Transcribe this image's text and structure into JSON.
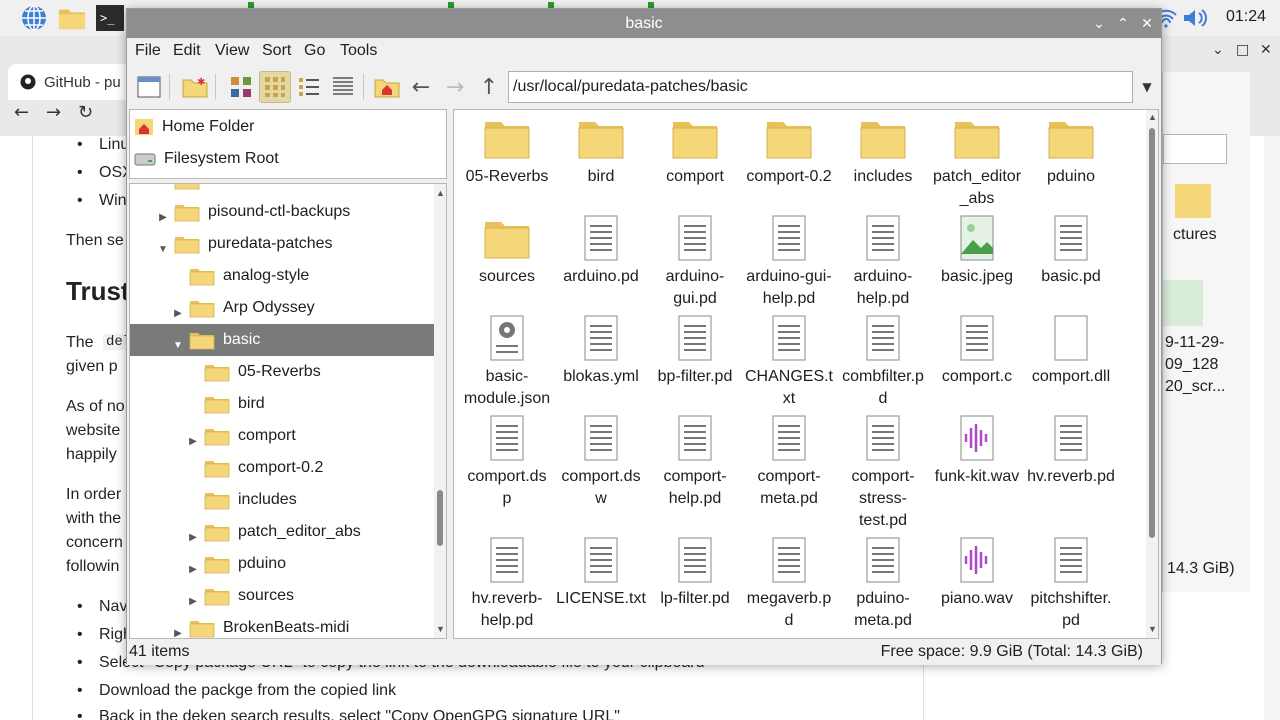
{
  "taskbar": {
    "clock": "01:24"
  },
  "browser": {
    "tab_label": "GitHub - pu",
    "doc_lines": {
      "linux": "Linu",
      "osx": "OSX",
      "win": "Win",
      "then": "Then se",
      "heading": "Trust",
      "the": "The",
      "code": "del",
      "given": "given p",
      "asof": "As of no",
      "website": "website",
      "happily": "happily",
      "inorder": "In order",
      "withthe": "with the",
      "concern": "concern",
      "following": "followin",
      "nav": "Nav",
      "right": "Righ",
      "select": "Select \"Copy package URL\" to copy the link to the downloadable file to your clipboard",
      "download": "Download the packge from the copied link",
      "back": "Back in the deken search results, select \"Copy OpenGPG signature URL\""
    },
    "right_win": {
      "label_1": "ctures",
      "label_2": "9-11-29-",
      "label_3": "09_128",
      "label_4": "20_scr...",
      "free": "14.3 GiB)"
    }
  },
  "file_manager": {
    "title": "basic",
    "menu": [
      "File",
      "Edit",
      "View",
      "Sort",
      "Go",
      "Tools"
    ],
    "path": "/usr/local/puredata-patches/basic",
    "places": [
      "Home Folder",
      "Filesystem Root"
    ],
    "tree": [
      {
        "label": "",
        "indent": 0,
        "arrow": ""
      },
      {
        "label": "pisound-ctl-backups",
        "indent": 0,
        "arrow": "▶"
      },
      {
        "label": "puredata-patches",
        "indent": 0,
        "arrow": "▼"
      },
      {
        "label": "analog-style",
        "indent": 1,
        "arrow": ""
      },
      {
        "label": "Arp Odyssey",
        "indent": 1,
        "arrow": "▶"
      },
      {
        "label": "basic",
        "indent": 1,
        "arrow": "▼",
        "selected": true
      },
      {
        "label": "05-Reverbs",
        "indent": 2,
        "arrow": ""
      },
      {
        "label": "bird",
        "indent": 2,
        "arrow": ""
      },
      {
        "label": "comport",
        "indent": 2,
        "arrow": "▶"
      },
      {
        "label": "comport-0.2",
        "indent": 2,
        "arrow": ""
      },
      {
        "label": "includes",
        "indent": 2,
        "arrow": ""
      },
      {
        "label": "patch_editor_abs",
        "indent": 2,
        "arrow": "▶"
      },
      {
        "label": "pduino",
        "indent": 2,
        "arrow": "▶"
      },
      {
        "label": "sources",
        "indent": 2,
        "arrow": "▶"
      },
      {
        "label": "BrokenBeats-midi",
        "indent": 1,
        "arrow": "▶"
      }
    ],
    "files": [
      {
        "l1": "05-Reverbs",
        "l2": "",
        "l3": "",
        "type": "folder"
      },
      {
        "l1": "bird",
        "l2": "",
        "l3": "",
        "type": "folder"
      },
      {
        "l1": "comport",
        "l2": "",
        "l3": "",
        "type": "folder"
      },
      {
        "l1": "comport-0.2",
        "l2": "",
        "l3": "",
        "type": "folder"
      },
      {
        "l1": "includes",
        "l2": "",
        "l3": "",
        "type": "folder"
      },
      {
        "l1": "patch_editor",
        "l2": "_abs",
        "l3": "",
        "type": "folder"
      },
      {
        "l1": "pduino",
        "l2": "",
        "l3": "",
        "type": "folder"
      },
      {
        "l1": "sources",
        "l2": "",
        "l3": "",
        "type": "folder"
      },
      {
        "l1": "arduino.pd",
        "l2": "",
        "l3": "",
        "type": "text"
      },
      {
        "l1": "arduino-",
        "l2": "gui.pd",
        "l3": "",
        "type": "text"
      },
      {
        "l1": "arduino-gui-",
        "l2": "help.pd",
        "l3": "",
        "type": "text"
      },
      {
        "l1": "arduino-",
        "l2": "help.pd",
        "l3": "",
        "type": "text"
      },
      {
        "l1": "basic.jpeg",
        "l2": "",
        "l3": "",
        "type": "image"
      },
      {
        "l1": "basic.pd",
        "l2": "",
        "l3": "",
        "type": "text"
      },
      {
        "l1": "basic-",
        "l2": "module.json",
        "l3": "",
        "type": "gear"
      },
      {
        "l1": "blokas.yml",
        "l2": "",
        "l3": "",
        "type": "text"
      },
      {
        "l1": "bp-filter.pd",
        "l2": "",
        "l3": "",
        "type": "text"
      },
      {
        "l1": "CHANGES.t",
        "l2": "xt",
        "l3": "",
        "type": "text"
      },
      {
        "l1": "combfilter.p",
        "l2": "d",
        "l3": "",
        "type": "text"
      },
      {
        "l1": "comport.c",
        "l2": "",
        "l3": "",
        "type": "text"
      },
      {
        "l1": "comport.dll",
        "l2": "",
        "l3": "",
        "type": "blank"
      },
      {
        "l1": "comport.ds",
        "l2": "p",
        "l3": "",
        "type": "text"
      },
      {
        "l1": "comport.ds",
        "l2": "w",
        "l3": "",
        "type": "text"
      },
      {
        "l1": "comport-",
        "l2": "help.pd",
        "l3": "",
        "type": "text"
      },
      {
        "l1": "comport-",
        "l2": "meta.pd",
        "l3": "",
        "type": "text"
      },
      {
        "l1": "comport-",
        "l2": "stress-",
        "l3": "test.pd",
        "type": "text"
      },
      {
        "l1": "funk-kit.wav",
        "l2": "",
        "l3": "",
        "type": "audio"
      },
      {
        "l1": "hv.reverb.pd",
        "l2": "",
        "l3": "",
        "type": "text"
      },
      {
        "l1": "hv.reverb-",
        "l2": "help.pd",
        "l3": "",
        "type": "text"
      },
      {
        "l1": "LICENSE.txt",
        "l2": "",
        "l3": "",
        "type": "text"
      },
      {
        "l1": "lp-filter.pd",
        "l2": "",
        "l3": "",
        "type": "text"
      },
      {
        "l1": "megaverb.p",
        "l2": "d",
        "l3": "",
        "type": "text"
      },
      {
        "l1": "pduino-",
        "l2": "meta.pd",
        "l3": "",
        "type": "text"
      },
      {
        "l1": "piano.wav",
        "l2": "",
        "l3": "",
        "type": "audio"
      },
      {
        "l1": "pitchshifter.",
        "l2": "pd",
        "l3": "",
        "type": "text"
      }
    ],
    "status": {
      "items": "41 items",
      "free": "Free space: 9.9 GiB (Total: 14.3 GiB)"
    }
  },
  "colors": {
    "folder": "#f5d77a",
    "folder_dark": "#e8c257",
    "title_bar": "#8e8e8e",
    "audio": "#b048c8",
    "selection": "#7a7a7a"
  }
}
